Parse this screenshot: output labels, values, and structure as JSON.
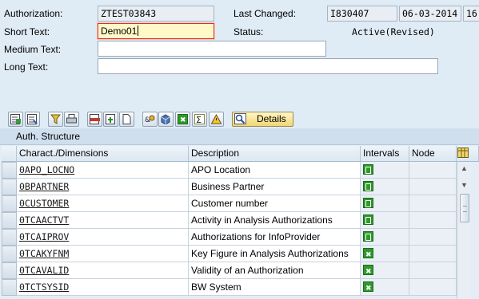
{
  "header": {
    "authorization_label": "Authorization:",
    "authorization_value": "ZTEST03843",
    "last_changed_label": "Last Changed:",
    "last_changed_user": "I830407",
    "last_changed_date": "06-03-2014",
    "last_changed_time": "16",
    "short_text_label": "Short Text:",
    "short_text_value": "Demo01",
    "status_label": "Status:",
    "status_value": "Active(Revised)",
    "medium_text_label": "Medium Text:",
    "medium_text_value": "",
    "long_text_label": "Long Text:",
    "long_text_value": ""
  },
  "toolbar": {
    "details_label": "Details"
  },
  "table": {
    "title": "Auth. Structure",
    "columns": [
      "Charact./Dimensions",
      "Description",
      "Intervals",
      "Node"
    ],
    "rows": [
      {
        "code": "0APO_LOCNO",
        "description": "APO Location",
        "interval": "bracket"
      },
      {
        "code": "0BPARTNER",
        "description": "Business Partner",
        "interval": "bracket"
      },
      {
        "code": "0CUSTOMER",
        "description": "Customer number",
        "interval": "bracket"
      },
      {
        "code": "0TCAACTVT",
        "description": "Activity in Analysis Authorizations",
        "interval": "bracket"
      },
      {
        "code": "0TCAIPROV",
        "description": "Authorizations for InfoProvider",
        "interval": "bracket"
      },
      {
        "code": "0TCAKYFNM",
        "description": "Key Figure in Analysis Authorizations",
        "interval": "cross"
      },
      {
        "code": "0TCAVALID",
        "description": "Validity of an Authorization",
        "interval": "cross"
      },
      {
        "code": "0TCTSYSID",
        "description": "BW System",
        "interval": "cross"
      }
    ]
  },
  "colors": {
    "background": "#dfebf5",
    "focus_field": "#fff9c8",
    "interval_icon": "#2f9a2b",
    "details_button": "#f2d676"
  }
}
